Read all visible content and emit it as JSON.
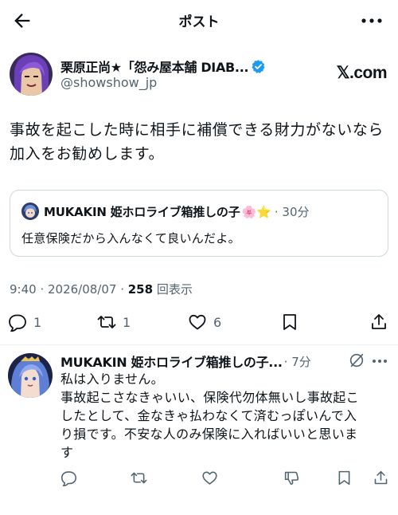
{
  "header": {
    "title": "ポスト"
  },
  "author": {
    "name": "栗原正尚★「怨み屋本舗 DIAB...",
    "handle": "@showshow_jp",
    "site_label": "𝕏.com"
  },
  "post": {
    "text_lines": [
      "事故を起こした時に相手に補償できる財力がないなら",
      "加入をお勧めします。"
    ],
    "quote": {
      "name": "MUKAKIN 姫ホロライブ箱推しの子",
      "emojis": "🌸⭐",
      "time": "· 30分",
      "text": "任意保険だから入んなくて良いんだよ。"
    },
    "meta": {
      "time_date": "9:40 · 2026/08/07 · ",
      "views_count": "258",
      "views_label": " 回表示"
    },
    "actions": {
      "reply_count": "1",
      "repost_count": "1",
      "like_count": "6"
    }
  },
  "reply": {
    "name": "MUKAKIN 姫ホロライブ箱推しの子...",
    "time": "· 7分",
    "text_lines": [
      "私は入りません。",
      "事故起こさなきゃいい、保険代勿体無いし事故起こ",
      "したとして、金なきゃ払わなくて済むっぽいんで入",
      "り損です。不安な人のみ保険に入ればいいと思いま",
      "す"
    ]
  },
  "colors": {
    "text": "#0f1419",
    "secondary": "#536471",
    "border": "#cfd9de",
    "verified": "#1d9bf0"
  }
}
